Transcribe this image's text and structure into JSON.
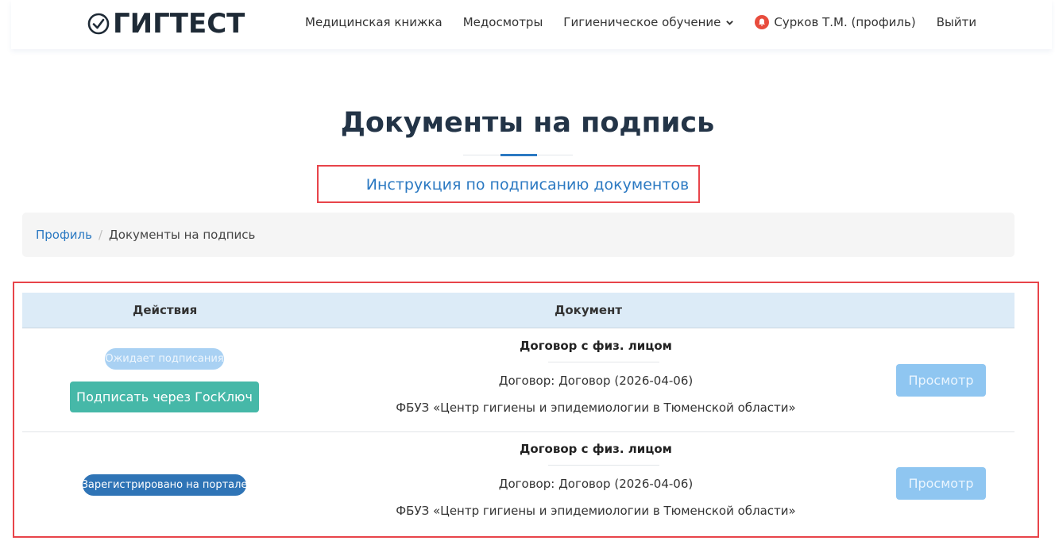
{
  "header": {
    "logo_text": "ГИГТЕСТ",
    "nav": [
      {
        "label": "Медицинская книжка"
      },
      {
        "label": "Медосмотры"
      },
      {
        "label": "Гигиеническое обучение"
      },
      {
        "label": "Сурков Т.М. (профиль)"
      },
      {
        "label": "Выйти"
      }
    ]
  },
  "page": {
    "title": "Документы на подпись",
    "instruction_link": "Инструкция по подписанию документов"
  },
  "breadcrumb": {
    "parent": "Профиль",
    "separator": "/",
    "current": "Документы на подпись"
  },
  "table": {
    "headers": {
      "actions": "Действия",
      "document": "Документ"
    },
    "rows": [
      {
        "status": "Ожидает подписания",
        "sign_button": "Подписать через ГосКлюч",
        "doc_title": "Договор с физ. лицом",
        "doc_contract": "Договор: Договор (2026-04-06)",
        "doc_org": "ФБУЗ «Центр гигиены и эпидемиологии в Тюменской области»",
        "view_button": "Просмотр"
      },
      {
        "status": "Зарегистрировано на портале",
        "doc_title": "Договор с физ. лицом",
        "doc_contract": "Договор: Договор (2026-04-06)",
        "doc_org": "ФБУЗ «Центр гигиены и эпидемиологии в Тюменской области»",
        "view_button": "Просмотр"
      }
    ]
  },
  "colors": {
    "accent_blue": "#2b79c2",
    "teal_button": "#46b8a8",
    "highlight_red": "#e8444a",
    "table_header_bg": "#dcebf7"
  }
}
